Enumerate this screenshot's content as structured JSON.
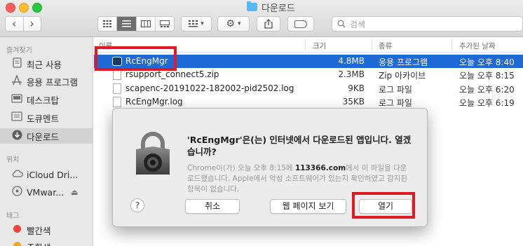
{
  "window": {
    "title": "다운로드"
  },
  "toolbar": {
    "back": "‹",
    "forward": "›",
    "search_placeholder": "검색"
  },
  "sidebar": {
    "favorites_header": "즐겨찾기",
    "favorites": [
      {
        "label": "최근 사용",
        "icon": "recents-icon"
      },
      {
        "label": "응용 프로그램",
        "icon": "applications-icon"
      },
      {
        "label": "데스크탑",
        "icon": "desktop-icon"
      },
      {
        "label": "도큐멘트",
        "icon": "documents-icon"
      },
      {
        "label": "다운로드",
        "icon": "downloads-icon",
        "selected": true
      }
    ],
    "locations_header": "위치",
    "locations": [
      {
        "label": "iCloud Dri...",
        "icon": "icloud-icon"
      },
      {
        "label": "VMwar...",
        "icon": "disk-icon"
      }
    ],
    "tags_header": "태그",
    "tags": [
      {
        "label": "빨간색",
        "color": "#f0443c"
      },
      {
        "label": "주황색",
        "color": "#f5a623"
      }
    ]
  },
  "list": {
    "columns": {
      "name": "이름",
      "size": "크기",
      "kind": "종류",
      "date": "추가된 날짜"
    },
    "rows": [
      {
        "name": "RcEngMgr",
        "size": "4.8MB",
        "kind": "응용 프로그램",
        "date": "오늘 오후 8:40",
        "icon": "app-icon",
        "selected": true
      },
      {
        "name": "rsupport_connect5.zip",
        "size": "2.3MB",
        "kind": "Zip 아카이브",
        "date": "오늘 오후 8:15",
        "icon": "zip-file-icon"
      },
      {
        "name": "scapenc-20191022-182002-pid2502.log",
        "size": "9KB",
        "kind": "로그 파일",
        "date": "오늘 오후 6:20",
        "icon": "log-file-icon"
      },
      {
        "name": "RcEngMgr.log",
        "size": "35KB",
        "kind": "로그 파일",
        "date": "오늘 오후 6:19",
        "icon": "log-file-icon"
      }
    ]
  },
  "dialog": {
    "title": "'RcEngMgr'은(는) 인터넷에서 다운로드된 앱입니다. 열겠습니까?",
    "message_pre": "Chrome이(가) 오늘 오후 8:15에 ",
    "message_site": "113366.com",
    "message_post": "에서 이 파일을 다운로드했습니다. Apple에서 악성 소프트웨어가 있는지 확인하였고 감지된 항목이 없습니다.",
    "help": "?",
    "cancel": "취소",
    "show_web": "웹 페이지 보기",
    "open": "열기"
  },
  "colors": {
    "selection": "#1d69d6",
    "highlight_box": "#e01922"
  }
}
